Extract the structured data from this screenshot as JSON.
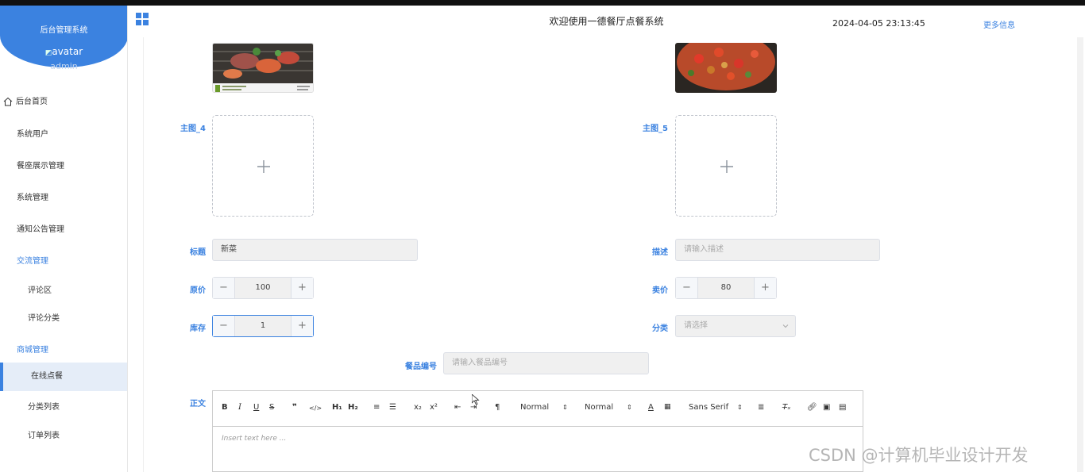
{
  "sidebar": {
    "system_name": "后台管理系统",
    "avatar_alt": "avatar",
    "username": "admin",
    "items": [
      {
        "label": "后台首页"
      },
      {
        "label": "系统用户"
      },
      {
        "label": "餐座展示管理"
      },
      {
        "label": "系统管理"
      },
      {
        "label": "通知公告管理"
      },
      {
        "label": "交流管理"
      },
      {
        "label": "评论区"
      },
      {
        "label": "评论分类"
      },
      {
        "label": "商城管理"
      },
      {
        "label": "在线点餐"
      },
      {
        "label": "分类列表"
      },
      {
        "label": "订单列表"
      }
    ]
  },
  "header": {
    "title": "欢迎使用一德餐厅点餐系统",
    "datetime": "2024-04-05 23:13:45",
    "more": "更多信息"
  },
  "form": {
    "main_image_4": "主图_4",
    "main_image_5": "主图_5",
    "title_label": "标题",
    "title_value": "新菜",
    "desc_label": "描述",
    "desc_placeholder": "请输入描述",
    "orig_price_label": "原价",
    "orig_price_value": "100",
    "sale_price_label": "卖价",
    "sale_price_value": "80",
    "stock_label": "库存",
    "stock_value": "1",
    "category_label": "分类",
    "category_placeholder": "请选择",
    "code_label": "餐品编号",
    "code_placeholder": "请输入餐品编号",
    "body_label": "正文"
  },
  "editor": {
    "header_select_1": "Normal",
    "header_select_2": "Normal",
    "font_select": "Sans Serif",
    "placeholder": "Insert text here ..."
  },
  "watermark": "CSDN @计算机毕业设计开发",
  "colors": {
    "accent": "#3b82e0",
    "sidebar_active": "#e5edf8"
  }
}
